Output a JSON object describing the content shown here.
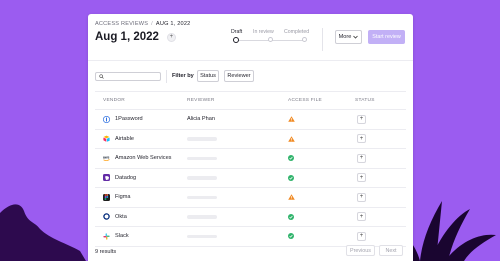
{
  "breadcrumb": {
    "parent": "ACCESS REVIEWS",
    "separator": "/",
    "current": "AUG 1, 2022"
  },
  "header": {
    "title": "Aug 1, 2022",
    "add_label": "+",
    "more_label": "More",
    "start_label": "Start review"
  },
  "stepper": {
    "steps": [
      {
        "label": "Draft",
        "active": true
      },
      {
        "label": "In review",
        "active": false
      },
      {
        "label": "Completed",
        "active": false
      }
    ]
  },
  "filters": {
    "search_placeholder": "",
    "filter_by_label": "Filter by",
    "chips": [
      "Status",
      "Reviewer"
    ]
  },
  "table": {
    "columns": [
      "VENDOR",
      "REVIEWER",
      "ACCESS FILE",
      "STATUS"
    ],
    "rows": [
      {
        "vendor": "1Password",
        "logo": "1password-logo",
        "reviewer": "Alicia Phan",
        "access_file": "warning"
      },
      {
        "vendor": "Airtable",
        "logo": "airtable-logo",
        "reviewer": "",
        "access_file": "warning"
      },
      {
        "vendor": "Amazon Web Services",
        "logo": "aws-logo",
        "reviewer": "",
        "access_file": "ok"
      },
      {
        "vendor": "Datadog",
        "logo": "datadog-logo",
        "reviewer": "",
        "access_file": "ok"
      },
      {
        "vendor": "Figma",
        "logo": "figma-logo",
        "reviewer": "",
        "access_file": "warning"
      },
      {
        "vendor": "Okta",
        "logo": "okta-logo",
        "reviewer": "",
        "access_file": "ok"
      },
      {
        "vendor": "Slack",
        "logo": "slack-logo",
        "reviewer": "",
        "access_file": "ok"
      }
    ]
  },
  "footer": {
    "results": "9 results",
    "previous": "Previous",
    "next": "Next"
  },
  "colors": {
    "background": "#9b5cf0",
    "accent_disabled": "#c2b0f6",
    "warning": "#f08a24",
    "ok": "#2fb36b"
  }
}
